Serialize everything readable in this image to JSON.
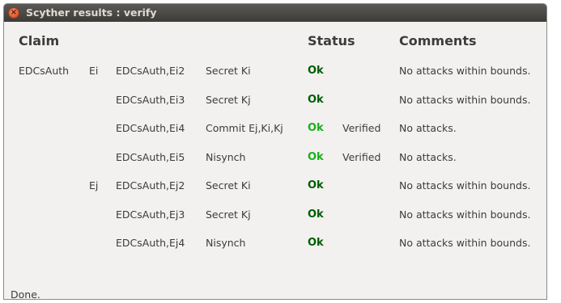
{
  "window": {
    "title": "Scyther results : verify"
  },
  "headers": {
    "claim": "Claim",
    "status": "Status",
    "comments": "Comments"
  },
  "rows": [
    {
      "protocol": "EDCsAuth",
      "role": "Ei",
      "id": "EDCsAuth,Ei2",
      "claim": "Secret Ki",
      "status": "Ok",
      "verified": "",
      "comment": "No attacks within bounds."
    },
    {
      "protocol": "",
      "role": "",
      "id": "EDCsAuth,Ei3",
      "claim": "Secret Kj",
      "status": "Ok",
      "verified": "",
      "comment": "No attacks within bounds."
    },
    {
      "protocol": "",
      "role": "",
      "id": "EDCsAuth,Ei4",
      "claim": "Commit Ej,Ki,Kj",
      "status": "Ok",
      "verified": "Verified",
      "comment": "No attacks."
    },
    {
      "protocol": "",
      "role": "",
      "id": "EDCsAuth,Ei5",
      "claim": "Nisynch",
      "status": "Ok",
      "verified": "Verified",
      "comment": "No attacks."
    },
    {
      "protocol": "",
      "role": "Ej",
      "id": "EDCsAuth,Ej2",
      "claim": "Secret Ki",
      "status": "Ok",
      "verified": "",
      "comment": "No attacks within bounds."
    },
    {
      "protocol": "",
      "role": "",
      "id": "EDCsAuth,Ej3",
      "claim": "Secret Kj",
      "status": "Ok",
      "verified": "",
      "comment": "No attacks within bounds."
    },
    {
      "protocol": "",
      "role": "",
      "id": "EDCsAuth,Ej4",
      "claim": "Nisynch",
      "status": "Ok",
      "verified": "",
      "comment": "No attacks within bounds."
    }
  ],
  "statusbar": {
    "text": "Done."
  },
  "colors": {
    "ok_bounded": "#005c00",
    "ok_verified": "#18b018"
  }
}
